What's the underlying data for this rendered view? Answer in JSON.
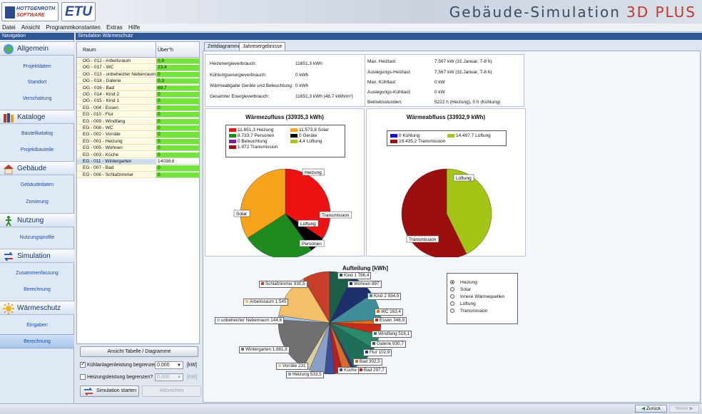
{
  "header": {
    "logo_line1": "HOTTGENROTH",
    "logo_line2": "SOFTWARE",
    "logo2": "ETU",
    "title": "Gebäude-Simulation",
    "title_suffix": "3D PLUS"
  },
  "menu": [
    "Datei",
    "Ansicht",
    "Programmkonstanten",
    "Extras",
    "Hilfe"
  ],
  "nav": {
    "header": "Navigation",
    "sections": [
      {
        "label": "Allgemein",
        "icon": "globe-icon",
        "items": [
          "Projektdaten",
          "Standort",
          "Verschattung"
        ]
      },
      {
        "label": "Kataloge",
        "icon": "books-icon",
        "items": [
          "Bauteilkatalog",
          "Projektbauteile"
        ]
      },
      {
        "label": "Gebäude",
        "icon": "house-icon",
        "items": [
          "Gebäudedaten",
          "Zonierung"
        ]
      },
      {
        "label": "Nutzung",
        "icon": "person-icon",
        "items": [
          "Nutzungsprofile"
        ]
      },
      {
        "label": "Simulation",
        "icon": "arrows-icon",
        "items": [
          "Zusammenfassung",
          "Berechnung"
        ]
      },
      {
        "label": "Wärmeschutz",
        "icon": "sun-icon",
        "items": [
          "Eingaben",
          "Berechnung"
        ]
      }
    ],
    "selected": "Berechnung"
  },
  "sim_header": "Simulation Wärmeschutz",
  "rooms": {
    "col_room": "Raum",
    "col_value": "Über°h",
    "rows": [
      {
        "name": "OG - 012 - Arbeitsraum",
        "value": "0,9",
        "color": "green"
      },
      {
        "name": "OG - 017 - WC",
        "value": "23,4",
        "color": "green"
      },
      {
        "name": "OG - 013 - unbeheizter Nebenraum",
        "value": "0",
        "color": "green"
      },
      {
        "name": "OG - 018 - Galerie",
        "value": "0,3",
        "color": "green"
      },
      {
        "name": "OG - 016 - Bad",
        "value": "69,7",
        "color": "green"
      },
      {
        "name": "OG - 014 - Kind 2",
        "value": "0",
        "color": "green"
      },
      {
        "name": "OG - 015 - Kind 1",
        "value": "0",
        "color": "green"
      },
      {
        "name": "EG - 004 - Essen",
        "value": "0",
        "color": "green"
      },
      {
        "name": "EG - 010 - Flur",
        "value": "0",
        "color": "green"
      },
      {
        "name": "EG - 009 - Windfang",
        "value": "0",
        "color": "green"
      },
      {
        "name": "EG - 008 - WC",
        "value": "0",
        "color": "green"
      },
      {
        "name": "EG - 002 - Vorräte",
        "value": "0",
        "color": "green"
      },
      {
        "name": "EG - 001 - Heizung",
        "value": "0",
        "color": "green"
      },
      {
        "name": "EG - 005 - Wohnen",
        "value": "0",
        "color": "green"
      },
      {
        "name": "EG - 003 - Küche",
        "value": "0",
        "color": "green"
      },
      {
        "name": "EG - 011 - Wintergarten",
        "value": "14038,6",
        "color": "white"
      },
      {
        "name": "EG - 007 - Bad",
        "value": "0",
        "color": "green"
      },
      {
        "name": "EG - 006 - Schlafzimmer",
        "value": "0",
        "color": "green"
      }
    ]
  },
  "controls": {
    "view_button": "Ansicht Tabelle / Diagramme",
    "cool_label": "Kühlanlagenleistung begrenzen?",
    "cool_value": "0,000",
    "cool_unit": "[kW]",
    "heat_label": "Heizungsleistung begrenzen?",
    "heat_value": "0,000",
    "heat_unit": "[kW]",
    "start_button": "Simulation starten",
    "abort_button": "Abbrechen"
  },
  "tabs": [
    "Zeitdiagramme",
    "Jahresergebnisse"
  ],
  "summary_left": [
    {
      "label": "Heizenergieverbrauch:",
      "value": "11651,3 kWh"
    },
    {
      "label": "Kühlungsenergieverbrauch:",
      "value": "0 kWh"
    },
    {
      "label": "Wärmeabgabe Geräte und Beleuchtung:",
      "value": "0 kWh"
    },
    {
      "label": "Gesamter Energieverbrauch:",
      "value": "11651,3 kWh (48,7 kWh/m²)"
    }
  ],
  "summary_right": [
    {
      "label": "Max. Heizlast:",
      "value": "7,567 kW (31.Januar, 7-8 h)"
    },
    {
      "label": "Auslegungs-Heizlast:",
      "value": "7,567 kW (31.Januar, 7-8 h)"
    },
    {
      "label": "Max. Kühllast:",
      "value": "0 kW"
    },
    {
      "label": "Auslegungs-Kühllast:",
      "value": "0 kW"
    },
    {
      "label": "Betriebsstunden:",
      "value": "5222 h (Heizung), 0 h (Kühlung)"
    }
  ],
  "radios": {
    "options": [
      "Heizung",
      "Solar",
      "Innere Wärmequellen",
      "Lüftung",
      "Transmission"
    ],
    "selected": 0
  },
  "footer": {
    "back": "Zurück",
    "next": "Weiter"
  },
  "chart_data": [
    {
      "type": "pie",
      "title": "Wärmezufluss (33935,3 kWh)",
      "legend": [
        "11.651,3 Heizung",
        "11.573,8 Solar",
        "8.733,7 Personen",
        "0 Geräte",
        "0 Beleuchtung",
        "4,4 Lüftung",
        "1.972 Transmission"
      ],
      "slices": [
        {
          "name": "Heizung",
          "value": 11651.3,
          "color": "#ee1111"
        },
        {
          "name": "Transmission",
          "value": 1972,
          "color": "#000000"
        },
        {
          "name": "Lüftung",
          "value": 4.4,
          "color": "#a3c616"
        },
        {
          "name": "Personen",
          "value": 8733.7,
          "color": "#1f8a1f"
        },
        {
          "name": "Solar",
          "value": 11573.8,
          "color": "#f6a21a"
        }
      ],
      "labels": [
        "Heizung",
        "Transmission",
        "Lüftung",
        "Personen",
        "Solar"
      ]
    },
    {
      "type": "pie",
      "title": "Wärmeabfluss (33932,9 kWh)",
      "legend": [
        "0 Kühlung",
        "14.497,7 Lüftung",
        "19.435,2 Transmission"
      ],
      "slices": [
        {
          "name": "Lüftung",
          "value": 14497.7,
          "color": "#a3c616"
        },
        {
          "name": "Transmission",
          "value": 19435.2,
          "color": "#9c0f0f"
        }
      ],
      "labels": [
        "Lüftung",
        "Transmission"
      ]
    },
    {
      "type": "pie",
      "title": "Aufteilung [kWh]",
      "slices": [
        {
          "name": "Kind 1",
          "value": 786.4,
          "label": "Kind 1 786,4",
          "color": "#1c5e49"
        },
        {
          "name": "Wohnen",
          "value": 897,
          "label": "Wohnen 897",
          "color": "#1e2f6e"
        },
        {
          "name": "Kind 2",
          "value": 934.5,
          "label": "Kind 2 934,5",
          "color": "#3f8f9a"
        },
        {
          "name": "WC",
          "value": 163.4,
          "label": "WC 163,4",
          "color": "#e66a1a"
        },
        {
          "name": "Essen",
          "value": 346.9,
          "label": "Essen 346,9",
          "color": "#c92a1a"
        },
        {
          "name": "Windfang",
          "value": 516.1,
          "label": "Windfang 516,1",
          "color": "#2b8a6a"
        },
        {
          "name": "Galerie",
          "value": 930.7,
          "label": "Galerie 930,7",
          "color": "#1f6e5a"
        },
        {
          "name": "Flur",
          "value": 102.9,
          "label": "Flur 102,9",
          "color": "#2a3a7a"
        },
        {
          "name": "Bad",
          "value": 302.5,
          "label": "Bad 302,5",
          "color": "#d86a2a"
        },
        {
          "name": "Bad",
          "value": 297.7,
          "label": "Bad 297,7",
          "color": "#b22020"
        },
        {
          "name": "Küche",
          "value": 331.7,
          "label": "Küche",
          "color": "#3a4f96"
        },
        {
          "name": "Heizung",
          "value": 533.5,
          "label": "Heizung 533,5",
          "color": "#8aa0c8"
        },
        {
          "name": "Vorräte",
          "value": 231,
          "label": "Vorräte 231",
          "color": "#d9cfa0"
        },
        {
          "name": "Wintergarten",
          "value": 1881.8,
          "label": "Wintergarten 1.881,8",
          "color": "#707070"
        },
        {
          "name": "unbeheizter Nebenraum",
          "value": 144.6,
          "label": "unbeheizter Nebenraum 144,6",
          "color": "#a9c6ea"
        },
        {
          "name": "Arbeitsraum",
          "value": 1545,
          "label": "Arbeitsraum 1.545",
          "color": "#f2c06a"
        },
        {
          "name": "Schlafzimmer",
          "value": 930.5,
          "label": "Schlafzimmer 930,5",
          "color": "#c83c2a"
        }
      ]
    }
  ]
}
